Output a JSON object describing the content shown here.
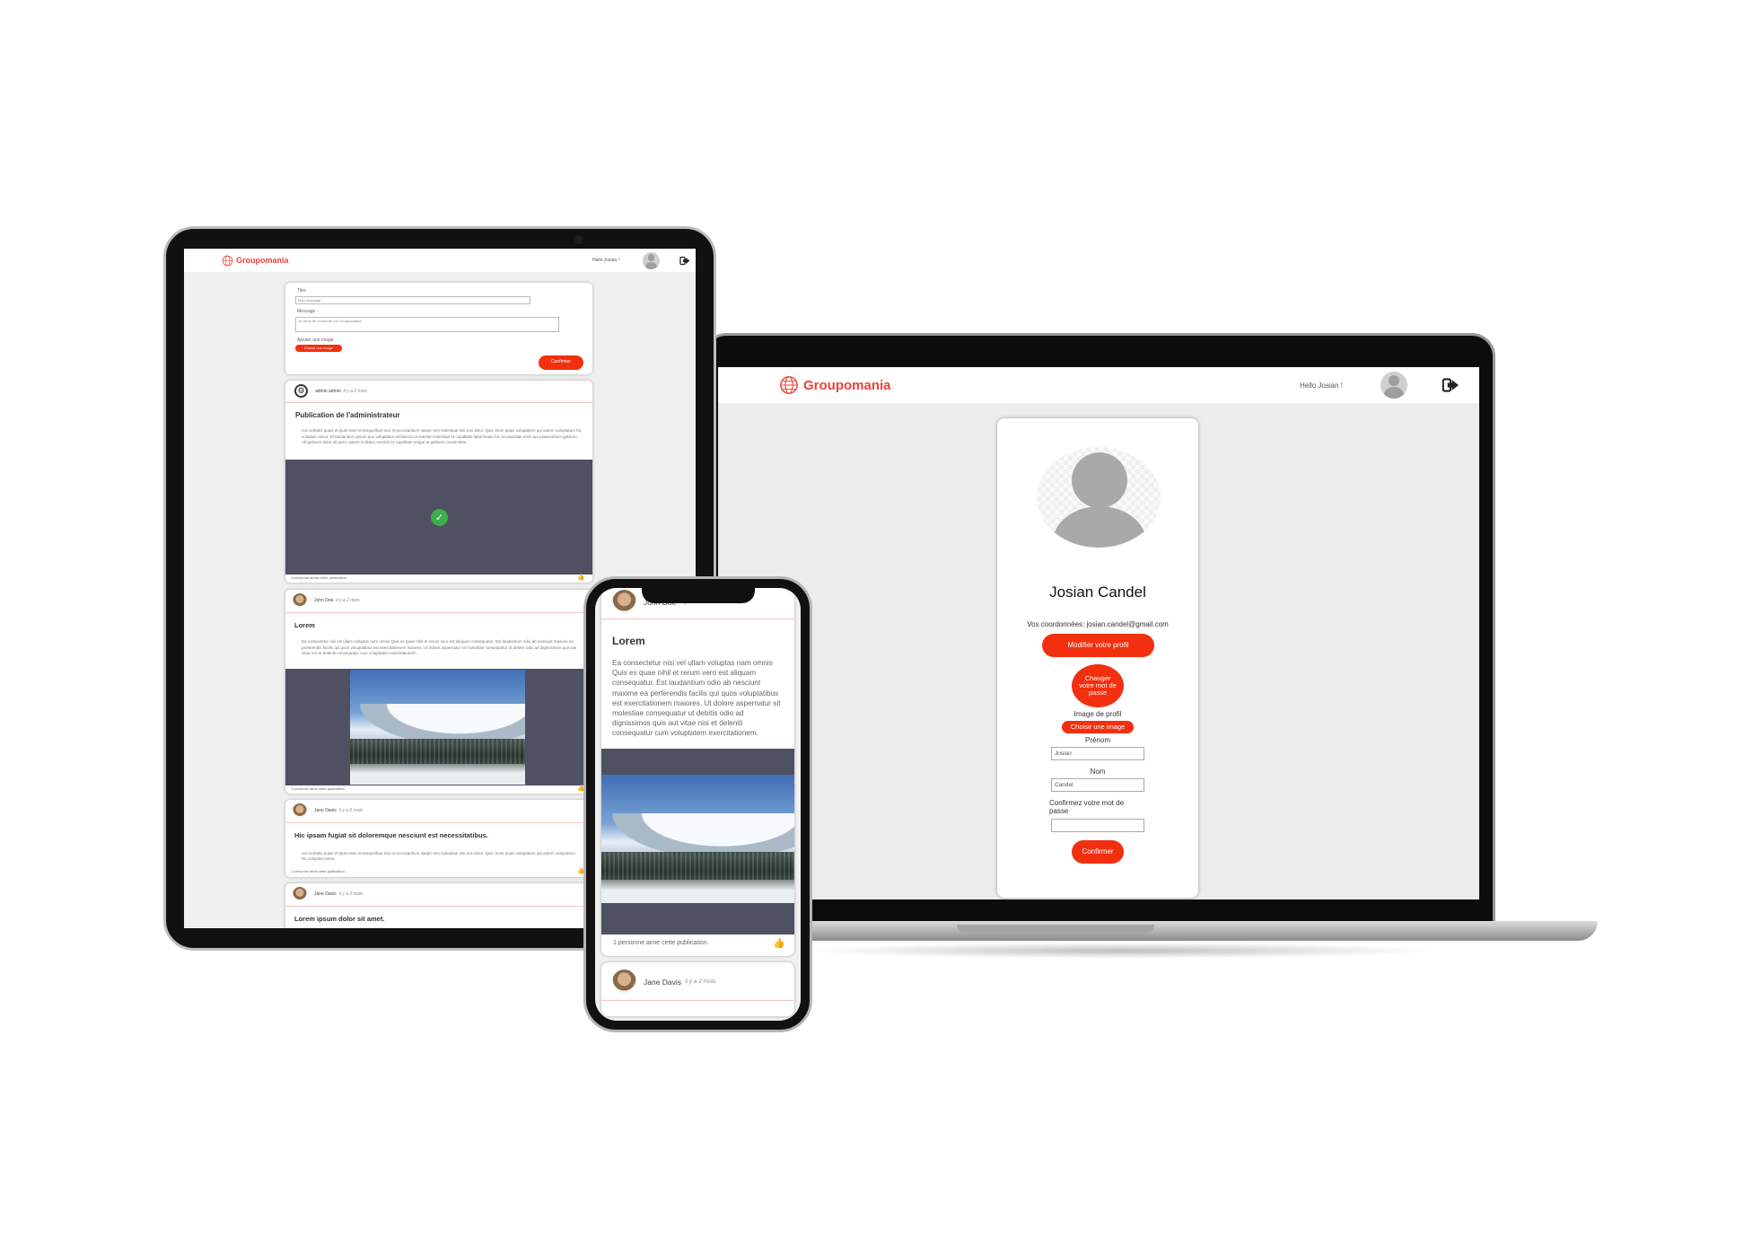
{
  "brand": {
    "name": "Groupomania",
    "color": "#e8433a"
  },
  "nav": {
    "greeting": "Hello Josian !",
    "logout_icon": "logout-icon",
    "avatar_icon": "user-avatar-icon"
  },
  "profile": {
    "name": "Josian Candel",
    "coordinates": "Vos coordonnées: josian.candel@gmail.com",
    "edit_button": "Modifier votre profil",
    "password_button": "Changer votre mot de passe",
    "image_label": "Image de profil",
    "image_button": "Choisir une image",
    "firstname_label": "Prénom",
    "firstname_value": "Josian",
    "lastname_label": "Nom",
    "lastname_value": "Candel",
    "confirm_pw_label": "Confirmez votre mot de passe",
    "confirm_button": "Confirmer",
    "button_color": "#f2300f"
  },
  "composer": {
    "title_label": "Titre",
    "title_placeholder": "Mon message",
    "message_label": "Message :",
    "message_placeholder": "Je viens de m'inscrire sur Groupomania",
    "image_label": "Ajouter une image",
    "image_button": "Choisir une image",
    "submit_button": "Confirmer"
  },
  "tablet_posts": [
    {
      "author": "admin admin",
      "time": "il y a 2 mois",
      "title": "Publication de l'administrateur",
      "text": "Aut veritatis quasi et Quis esse et temporibus eius et accusantium saepe rem molestiae nisi eos dolor. Quis. Eum quasi voluptatum qui autem voluptatum hic voluptas nemo. Et laudantium ipsum quo voluptates architecto ut eveniet molestiae et cupiditate laboriosam hic recusandae enim qui praesentium galisum. Ab galisum dolor sit porro autem At libero eveniet et cupiditate neque et galisum consectetur.",
      "likes": "1 personne aimes cette publication."
    },
    {
      "author": "John Doe",
      "time": "il y a 2 mois",
      "title": "Lorem",
      "text": "Ea consectetur nisi vel ullam voluptas nam omnis Quis ex quae nihil et rerum vero est aliquam consequatur. Est laudantium odio ab nesciunt maxime ea perferendis facilis qui quos voluptatibus est exercitationem maiores. Ut dolore aspernatur sit molestiae consequatur ut debitis odio ad dignissimos quis aut vitae nisi et deleniti consequatur cum voluptatem exercitationem.",
      "likes": "1 personne aime cette publication."
    },
    {
      "author": "Jane Davis",
      "time": "il y a 2 mois",
      "title": "Hic ipsam fugiat sit doloremque nesciunt est necessitatibus.",
      "text": "Aut veritatis quasi et Quis esse et temporibus eius et accusantium saepe rem molestiae nisi eos dolor. Quis. Eum quasi voluptatum qui autem voluptatum hic voluptas nemo.",
      "likes": "1 personne aime cette publication."
    },
    {
      "author": "Jane Davis",
      "time": "il y a 2 mois",
      "title": "Lorem ipsum dolor sit amet."
    }
  ],
  "phone_posts": [
    {
      "author": "John Doe",
      "time": "il y a 2 mois",
      "title": "Lorem",
      "text": "Ea consectetur nisi vel ullam voluptas nam omnis Quis ex quae nihil et rerum vero est aliquam consequatur. Est laudantium odio ab nesciunt maxime ea perferendis facilis qui quos voluptatibus est exercitationem maiores. Ut dolore aspernatur sit molestiae consequatur ut debitis odio ad dignissimos quis aut vitae nisi et deleniti consequatur cum voluptatem exercitationem.",
      "likes": "1 personne aime cette publication."
    },
    {
      "author": "Jane Davis",
      "time": "il y a 2 mois"
    }
  ]
}
